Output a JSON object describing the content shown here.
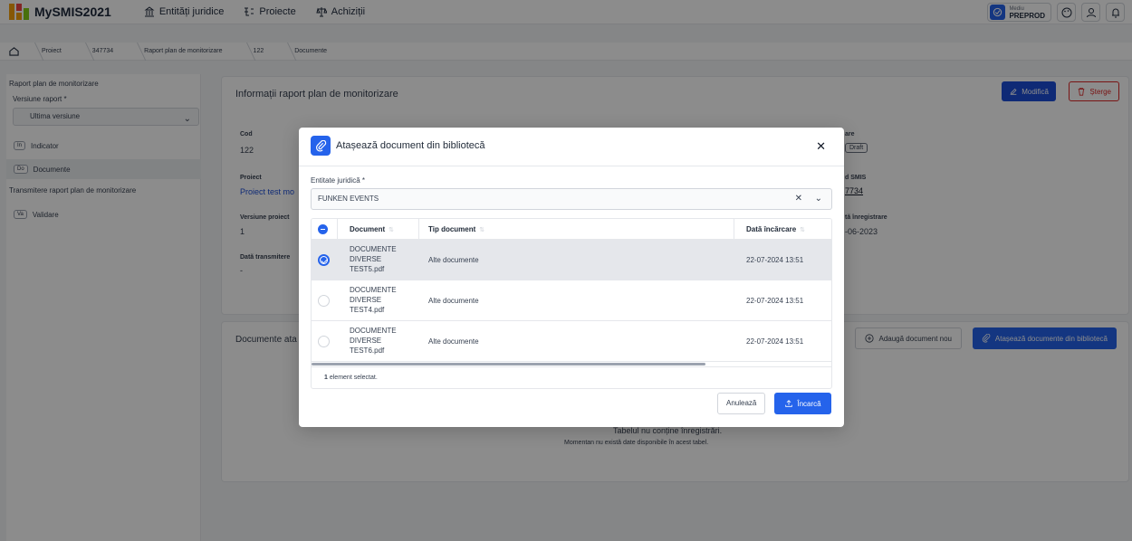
{
  "app": {
    "title": "MySMIS2021"
  },
  "topnav": {
    "items": [
      "Entități juridice",
      "Proiecte",
      "Achiziții"
    ]
  },
  "env": {
    "small": "Mediu",
    "name": "PREPROD"
  },
  "breadcrumb": [
    "Proiect",
    "347734",
    "Raport plan de monitorizare",
    "122",
    "Documente"
  ],
  "sidebar": {
    "title": "Raport plan de monitorizare",
    "version_label": "Versiune raport *",
    "version_value": "Ultima versiune",
    "items": [
      {
        "badge": "In",
        "label": "Indicator"
      },
      {
        "badge": "Do",
        "label": "Documente"
      }
    ],
    "section": "Transmitere raport plan de monitorizare",
    "section_items": [
      {
        "badge": "Va",
        "label": "Validare"
      }
    ]
  },
  "panel_info": {
    "title": "Informații raport plan de monitorizare",
    "modify": "Modifică",
    "delete": "Șterge",
    "fields": {
      "cod_label": "Cod",
      "cod_value": "122",
      "proiect_label": "Proiect",
      "proiect_value": "Proiect test mo",
      "versiune_label": "Versiune proiect",
      "versiune_value": "1",
      "transmitere_label": "Dată transmitere",
      "transmitere_value": "-",
      "stare_label": "are",
      "stare_value": "Draft",
      "smis_label": "d SMIS",
      "smis_value": "7734",
      "inreg_label": "tă înregistrare",
      "inreg_value": "-06-2023"
    }
  },
  "panel_docs": {
    "title": "Documente ata",
    "add_new": "Adaugă document nou",
    "attach_lib": "Atașează documente din bibliotecă",
    "empty_title": "Tabelul nu conține înregistrări.",
    "empty_sub": "Momentan nu există date disponibile în acest tabel."
  },
  "modal": {
    "title": "Atașează document din bibliotecă",
    "entity_label": "Entitate juridică *",
    "entity_value": "FUNKEN EVENTS",
    "columns": [
      "Document",
      "Tip document",
      "Dată încărcare"
    ],
    "rows": [
      {
        "doc": [
          "DOCUMENTE",
          "DIVERSE",
          "TEST5.pdf"
        ],
        "type": "Alte documente",
        "date": "22-07-2024 13:51",
        "selected": true
      },
      {
        "doc": [
          "DOCUMENTE",
          "DIVERSE",
          "TEST4.pdf"
        ],
        "type": "Alte documente",
        "date": "22-07-2024 13:51",
        "selected": false
      },
      {
        "doc": [
          "DOCUMENTE",
          "DIVERSE",
          "TEST6.pdf"
        ],
        "type": "Alte documente",
        "date": "22-07-2024 13:51",
        "selected": false
      }
    ],
    "selected_count": "1",
    "selected_text": "element selectat.",
    "cancel": "Anulează",
    "upload": "Încarcă"
  },
  "colors": {
    "primary": "#2563eb",
    "danger": "#dc2626"
  }
}
